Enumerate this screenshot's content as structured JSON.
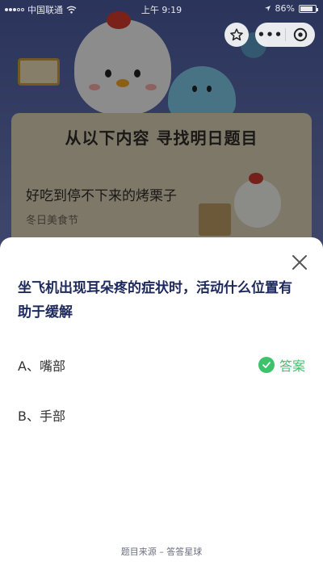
{
  "status_bar": {
    "carrier": "中国联通",
    "time": "上午 9:19",
    "battery": "86%",
    "battery_level": 0.86
  },
  "nav": {
    "star_icon": "star-outline-icon",
    "more_label": "•••",
    "close_icon": "circle-close-icon"
  },
  "background_card": {
    "title": "从以下内容  寻找明日题目",
    "subtitle": "好吃到停不下来的烤栗子",
    "tag": "冬日美食节"
  },
  "sheet": {
    "question": "坐飞机出现耳朵疼的症状时，活动什么位置有助于缓解",
    "options": [
      {
        "label": "A、嘴部",
        "is_answer": true
      },
      {
        "label": "B、手部",
        "is_answer": false
      }
    ],
    "answer_label": "答案",
    "source": "题目来源 – 答答星球"
  },
  "colors": {
    "answer_green": "#3cc26a",
    "question_text": "#1e2a5c"
  }
}
